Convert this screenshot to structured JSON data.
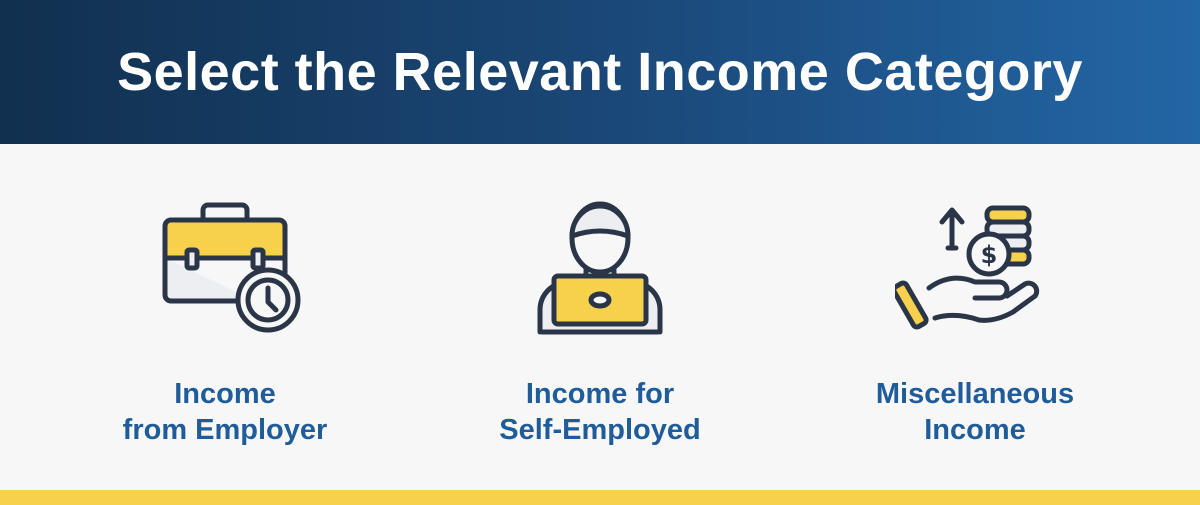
{
  "header": {
    "title": "Select the Relevant Income Category"
  },
  "categories": [
    {
      "line1": "Income",
      "line2": "from Employer",
      "icon": "briefcase-clock-icon"
    },
    {
      "line1": "Income for",
      "line2": "Self-Employed",
      "icon": "person-laptop-icon"
    },
    {
      "line1": "Miscellaneous",
      "line2": "Income",
      "icon": "hand-coins-dollar-icon"
    }
  ],
  "colors": {
    "banner_start": "#11304f",
    "banner_end": "#2366a5",
    "label": "#1f5c99",
    "accent_yellow": "#f7d14c",
    "icon_stroke": "#2b3548",
    "background": "#f7f7f7"
  }
}
